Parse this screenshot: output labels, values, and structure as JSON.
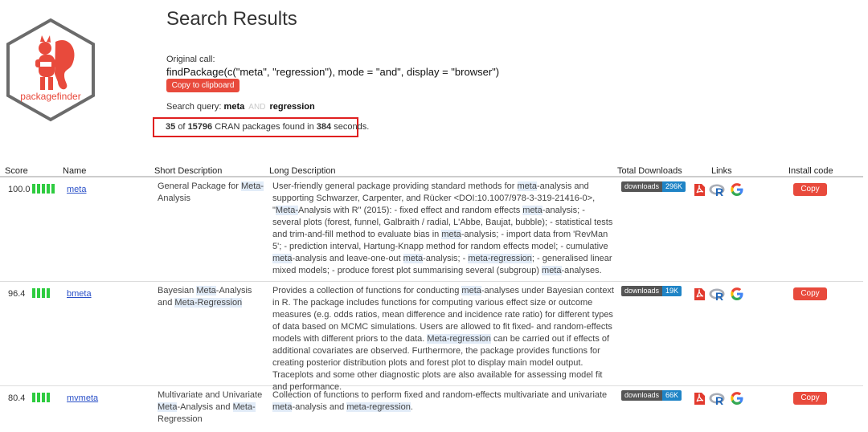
{
  "brand": {
    "logo_text": "packagefinder",
    "accent": "#e84a3c"
  },
  "header": {
    "title": "Search Results",
    "original_call_label": "Original call:",
    "original_call": "findPackage(c(\"meta\", \"regression\"), mode = \"and\", display = \"browser\")",
    "copy_clipboard_label": "Copy to clipboard",
    "query_label": "Search query:",
    "query_term1": "meta",
    "query_operator": "AND",
    "query_term2": "regression",
    "found_count": "35",
    "found_of": "of",
    "found_total": "15796",
    "found_middle": "CRAN packages found in",
    "found_seconds": "384",
    "found_suffix": "seconds."
  },
  "table": {
    "columns": [
      "Score",
      "Name",
      "Short Description",
      "Long Description",
      "Total Downloads",
      "Links",
      "Install code"
    ],
    "rows": [
      {
        "score": "100.0",
        "bars": 5,
        "name": "meta",
        "short": [
          {
            "t": "General Package for "
          },
          {
            "t": "Meta-",
            "h": true
          },
          {
            "t": "Analysis"
          }
        ],
        "long": [
          {
            "t": "User-friendly general package providing standard methods for "
          },
          {
            "t": "meta",
            "h": true
          },
          {
            "t": "-analysis and supporting Schwarzer, Carpenter, and Rücker <DOI:10.1007/978-3-319-21416-0>, \""
          },
          {
            "t": "Meta-",
            "h": true
          },
          {
            "t": "Analysis with R\" (2015): - fixed effect and random effects "
          },
          {
            "t": "meta",
            "h": true
          },
          {
            "t": "-analysis; - several plots (forest, funnel, Galbraith / radial, L'Abbe, Baujat, bubble); - statistical tests and trim-and-fill method to evaluate bias in "
          },
          {
            "t": "meta",
            "h": true
          },
          {
            "t": "-analysis; - import data from 'RevMan 5'; - prediction interval, Hartung-Knapp method for random effects model; - cumulative "
          },
          {
            "t": "meta",
            "h": true
          },
          {
            "t": "-analysis and leave-one-out "
          },
          {
            "t": "meta",
            "h": true
          },
          {
            "t": "-analysis; - "
          },
          {
            "t": "meta-regression",
            "h": true
          },
          {
            "t": "; - generalised linear mixed models; - produce forest plot summarising several (subgroup) "
          },
          {
            "t": "meta",
            "h": true
          },
          {
            "t": "-analyses."
          }
        ],
        "downloads_label": "downloads",
        "downloads": "296K",
        "copy_label": "Copy"
      },
      {
        "score": "96.4",
        "bars": 4,
        "name": "bmeta",
        "short": [
          {
            "t": "Bayesian "
          },
          {
            "t": "Meta",
            "h": true
          },
          {
            "t": "-Analysis and "
          },
          {
            "t": "Meta-Regression",
            "h": true
          }
        ],
        "long": [
          {
            "t": "Provides a collection of functions for conducting "
          },
          {
            "t": "meta",
            "h": true
          },
          {
            "t": "-analyses under Bayesian context in R. The package includes functions for computing various effect size or outcome measures (e.g. odds ratios, mean difference and incidence rate ratio) for different types of data based on MCMC simulations. Users are allowed to fit fixed- and random-effects models with different priors to the data. "
          },
          {
            "t": "Meta-regression",
            "h": true
          },
          {
            "t": " can be carried out if effects of additional covariates are observed. Furthermore, the package provides functions for creating posterior distribution plots and forest plot to display main model output. Traceplots and some other diagnostic plots are also available for assessing model fit and performance."
          }
        ],
        "downloads_label": "downloads",
        "downloads": "19K",
        "copy_label": "Copy"
      },
      {
        "score": "80.4",
        "bars": 4,
        "name": "mvmeta",
        "short": [
          {
            "t": "Multivariate and Univariate "
          },
          {
            "t": "Meta",
            "h": true
          },
          {
            "t": "-Analysis and "
          },
          {
            "t": "Meta-",
            "h": true
          },
          {
            "t": "Regression"
          }
        ],
        "long": [
          {
            "t": "Collection of functions to perform fixed and random-effects multivariate and univariate "
          },
          {
            "t": "meta",
            "h": true
          },
          {
            "t": "-analysis and "
          },
          {
            "t": "meta-regression",
            "h": true
          },
          {
            "t": "."
          }
        ],
        "downloads_label": "downloads",
        "downloads": "66K",
        "copy_label": "Copy"
      }
    ],
    "link_icons": [
      "pdf-icon",
      "r-logo-icon",
      "google-icon"
    ]
  }
}
